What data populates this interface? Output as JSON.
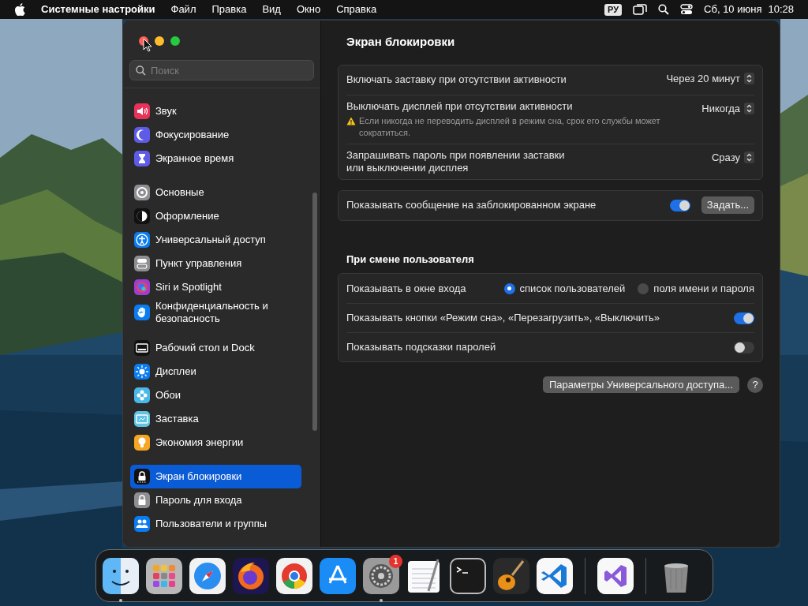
{
  "menu_bar": {
    "app_name": "Системные настройки",
    "menus": [
      "Файл",
      "Правка",
      "Вид",
      "Окно",
      "Справка"
    ],
    "input_source": "РУ",
    "date": "Сб, 10 июня",
    "time": "10:28"
  },
  "sidebar": {
    "search": {
      "placeholder": "Поиск"
    },
    "groups": [
      [
        {
          "label": "Звук",
          "color": "#e8325a",
          "selected": false
        },
        {
          "label": "Фокусирование",
          "color": "#5e5ce6",
          "selected": false
        },
        {
          "label": "Экранное время",
          "color": "#5e5ce6",
          "selected": false
        }
      ],
      [
        {
          "label": "Основные",
          "color": "#8e8e93",
          "selected": false
        },
        {
          "label": "Оформление",
          "color": "#111111",
          "selected": false
        },
        {
          "label": "Универсальный доступ",
          "color": "#0a7cf0",
          "selected": false
        },
        {
          "label": "Пункт управления",
          "color": "#8e8e93",
          "selected": false
        },
        {
          "label": "Siri и Spotlight",
          "color": "#9b3fd0",
          "selected": false
        },
        {
          "label": "Конфиденциальность и безопасность",
          "color": "#0a7cf0",
          "selected": false
        }
      ],
      [
        {
          "label": "Рабочий стол и Dock",
          "color": "#111111",
          "selected": false
        },
        {
          "label": "Дисплеи",
          "color": "#0a7cf0",
          "selected": false
        },
        {
          "label": "Обои",
          "color": "#49b8e8",
          "selected": false
        },
        {
          "label": "Заставка",
          "color": "#5fc3e4",
          "selected": false
        },
        {
          "label": "Экономия энергии",
          "color": "#f5a623",
          "selected": false
        }
      ],
      [
        {
          "label": "Экран блокировки",
          "color": "#111111",
          "selected": true
        },
        {
          "label": "Пароль для входа",
          "color": "#8e8e93",
          "selected": false
        },
        {
          "label": "Пользователи и группы",
          "color": "#0a7cf0",
          "selected": false
        }
      ]
    ]
  },
  "content": {
    "title": "Экран блокировки",
    "sections": [
      {
        "rows": [
          {
            "kind": "popup",
            "label": "Включать заставку при отсутствии активности",
            "value": "Через 20 минут"
          },
          {
            "kind": "popup",
            "label": "Выключать дисплей при отсутствии активности",
            "note": "Если никогда не переводить дисплей в режим сна, срок его службы может сократиться.",
            "value": "Никогда"
          },
          {
            "kind": "popup",
            "label": "Запрашивать пароль при появлении заставки или выключении дисплея",
            "value": "Сразу"
          }
        ]
      },
      {
        "rows": [
          {
            "kind": "toggle",
            "label": "Показывать сообщение на заблокированном экране",
            "on": true,
            "button": "Задать..."
          }
        ]
      },
      {
        "heading": "При смене пользователя",
        "rows": [
          {
            "kind": "radio",
            "label": "Показывать в окне входа",
            "options": [
              {
                "label": "список пользователей",
                "selected": true
              },
              {
                "label": "поля имени и пароля",
                "selected": false
              }
            ]
          },
          {
            "kind": "toggle",
            "label": "Показывать кнопки «Режим сна», «Перезагрузить», «Выключить»",
            "on": true
          },
          {
            "kind": "toggle",
            "label": "Показывать подсказки паролей",
            "on": false
          }
        ]
      }
    ],
    "footer": {
      "button": "Параметры Универсального доступа...",
      "help": "?"
    }
  },
  "dock": {
    "items": [
      {
        "kind": "app",
        "running": true
      },
      {
        "kind": "app",
        "running": false
      },
      {
        "kind": "app",
        "running": false
      },
      {
        "kind": "app",
        "running": false
      },
      {
        "kind": "app",
        "running": false
      },
      {
        "kind": "app",
        "running": false
      },
      {
        "kind": "app",
        "running": true,
        "badge": "1"
      },
      {
        "kind": "app",
        "running": false
      },
      {
        "kind": "app",
        "running": false
      },
      {
        "kind": "app",
        "running": false
      },
      {
        "kind": "app",
        "running": false
      },
      {
        "kind": "separator"
      },
      {
        "kind": "app",
        "running": false
      },
      {
        "kind": "separator"
      },
      {
        "kind": "app",
        "running": false
      }
    ]
  }
}
